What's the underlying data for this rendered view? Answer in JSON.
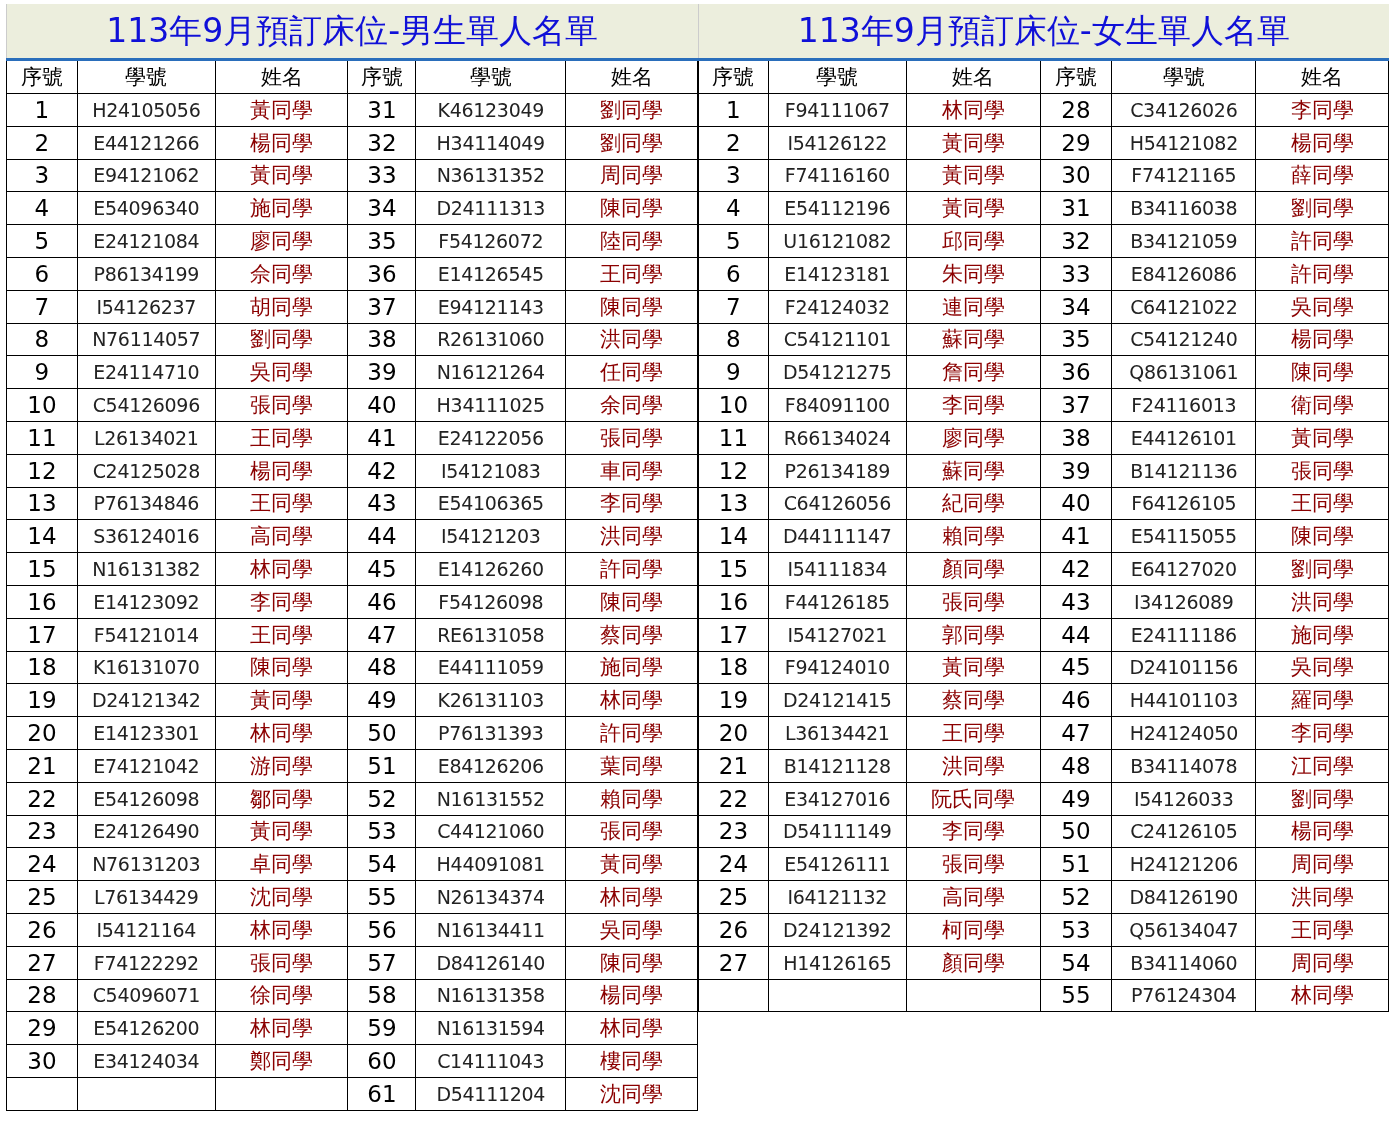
{
  "sheets": [
    {
      "title": "113年9月預訂床位-男生單人名單",
      "columns": [
        "序號",
        "學號",
        "姓名",
        "序號",
        "學號",
        "姓名"
      ],
      "left": [
        {
          "no": "1",
          "id": "H24105056",
          "name": "黃同學"
        },
        {
          "no": "2",
          "id": "E44121266",
          "name": "楊同學"
        },
        {
          "no": "3",
          "id": "E94121062",
          "name": "黃同學"
        },
        {
          "no": "4",
          "id": "E54096340",
          "name": "施同學"
        },
        {
          "no": "5",
          "id": "E24121084",
          "name": "廖同學"
        },
        {
          "no": "6",
          "id": "P86134199",
          "name": "佘同學"
        },
        {
          "no": "7",
          "id": "I54126237",
          "name": "胡同學"
        },
        {
          "no": "8",
          "id": "N76114057",
          "name": "劉同學"
        },
        {
          "no": "9",
          "id": "E24114710",
          "name": "吳同學"
        },
        {
          "no": "10",
          "id": "C54126096",
          "name": "張同學"
        },
        {
          "no": "11",
          "id": "L26134021",
          "name": "王同學"
        },
        {
          "no": "12",
          "id": "C24125028",
          "name": "楊同學"
        },
        {
          "no": "13",
          "id": "P76134846",
          "name": "王同學"
        },
        {
          "no": "14",
          "id": "S36124016",
          "name": "高同學"
        },
        {
          "no": "15",
          "id": "N16131382",
          "name": "林同學"
        },
        {
          "no": "16",
          "id": "E14123092",
          "name": "李同學"
        },
        {
          "no": "17",
          "id": "F54121014",
          "name": "王同學"
        },
        {
          "no": "18",
          "id": "K16131070",
          "name": "陳同學"
        },
        {
          "no": "19",
          "id": "D24121342",
          "name": "黃同學"
        },
        {
          "no": "20",
          "id": "E14123301",
          "name": "林同學"
        },
        {
          "no": "21",
          "id": "E74121042",
          "name": "游同學"
        },
        {
          "no": "22",
          "id": "E54126098",
          "name": "鄒同學"
        },
        {
          "no": "23",
          "id": "E24126490",
          "name": "黃同學"
        },
        {
          "no": "24",
          "id": "N76131203",
          "name": "卓同學"
        },
        {
          "no": "25",
          "id": "L76134429",
          "name": "沈同學"
        },
        {
          "no": "26",
          "id": "I54121164",
          "name": "林同學"
        },
        {
          "no": "27",
          "id": "F74122292",
          "name": "張同學"
        },
        {
          "no": "28",
          "id": "C54096071",
          "name": "徐同學"
        },
        {
          "no": "29",
          "id": "E54126200",
          "name": "林同學"
        },
        {
          "no": "30",
          "id": "E34124034",
          "name": "鄭同學"
        }
      ],
      "right": [
        {
          "no": "31",
          "id": "K46123049",
          "name": "劉同學"
        },
        {
          "no": "32",
          "id": "H34114049",
          "name": "劉同學"
        },
        {
          "no": "33",
          "id": "N36131352",
          "name": "周同學"
        },
        {
          "no": "34",
          "id": "D24111313",
          "name": "陳同學"
        },
        {
          "no": "35",
          "id": "F54126072",
          "name": "陸同學"
        },
        {
          "no": "36",
          "id": "E14126545",
          "name": "王同學"
        },
        {
          "no": "37",
          "id": "E94121143",
          "name": "陳同學"
        },
        {
          "no": "38",
          "id": "R26131060",
          "name": "洪同學"
        },
        {
          "no": "39",
          "id": "N16121264",
          "name": "任同學"
        },
        {
          "no": "40",
          "id": "H34111025",
          "name": "余同學"
        },
        {
          "no": "41",
          "id": "E24122056",
          "name": "張同學"
        },
        {
          "no": "42",
          "id": "I54121083",
          "name": "車同學"
        },
        {
          "no": "43",
          "id": "E54106365",
          "name": "李同學"
        },
        {
          "no": "44",
          "id": "I54121203",
          "name": "洪同學"
        },
        {
          "no": "45",
          "id": "E14126260",
          "name": "許同學"
        },
        {
          "no": "46",
          "id": "F54126098",
          "name": "陳同學"
        },
        {
          "no": "47",
          "id": "RE6131058",
          "name": "蔡同學"
        },
        {
          "no": "48",
          "id": "E44111059",
          "name": "施同學"
        },
        {
          "no": "49",
          "id": "K26131103",
          "name": "林同學"
        },
        {
          "no": "50",
          "id": "P76131393",
          "name": "許同學"
        },
        {
          "no": "51",
          "id": "E84126206",
          "name": "葉同學"
        },
        {
          "no": "52",
          "id": "N16131552",
          "name": "賴同學"
        },
        {
          "no": "53",
          "id": "C44121060",
          "name": "張同學"
        },
        {
          "no": "54",
          "id": "H44091081",
          "name": "黃同學"
        },
        {
          "no": "55",
          "id": "N26134374",
          "name": "林同學"
        },
        {
          "no": "56",
          "id": "N16134411",
          "name": "吳同學"
        },
        {
          "no": "57",
          "id": "D84126140",
          "name": "陳同學"
        },
        {
          "no": "58",
          "id": "N16131358",
          "name": "楊同學"
        },
        {
          "no": "59",
          "id": "N16131594",
          "name": "林同學"
        },
        {
          "no": "60",
          "id": "C14111043",
          "name": "樓同學"
        },
        {
          "no": "61",
          "id": "D54111204",
          "name": "沈同學"
        }
      ]
    },
    {
      "title": "113年9月預訂床位-女生單人名單",
      "columns": [
        "序號",
        "學號",
        "姓名",
        "序號",
        "學號",
        "姓名"
      ],
      "left": [
        {
          "no": "1",
          "id": "F94111067",
          "name": "林同學"
        },
        {
          "no": "2",
          "id": "I54126122",
          "name": "黃同學"
        },
        {
          "no": "3",
          "id": "F74116160",
          "name": "黃同學"
        },
        {
          "no": "4",
          "id": "E54112196",
          "name": "黃同學"
        },
        {
          "no": "5",
          "id": "U16121082",
          "name": "邱同學"
        },
        {
          "no": "6",
          "id": "E14123181",
          "name": "朱同學"
        },
        {
          "no": "7",
          "id": "F24124032",
          "name": "連同學"
        },
        {
          "no": "8",
          "id": "C54121101",
          "name": "蘇同學"
        },
        {
          "no": "9",
          "id": "D54121275",
          "name": "詹同學"
        },
        {
          "no": "10",
          "id": "F84091100",
          "name": "李同學"
        },
        {
          "no": "11",
          "id": "R66134024",
          "name": "廖同學"
        },
        {
          "no": "12",
          "id": "P26134189",
          "name": "蘇同學"
        },
        {
          "no": "13",
          "id": "C64126056",
          "name": "紀同學"
        },
        {
          "no": "14",
          "id": "D44111147",
          "name": "賴同學"
        },
        {
          "no": "15",
          "id": "I54111834",
          "name": "顏同學"
        },
        {
          "no": "16",
          "id": "F44126185",
          "name": "張同學"
        },
        {
          "no": "17",
          "id": "I54127021",
          "name": "郭同學"
        },
        {
          "no": "18",
          "id": "F94124010",
          "name": "黃同學"
        },
        {
          "no": "19",
          "id": "D24121415",
          "name": "蔡同學"
        },
        {
          "no": "20",
          "id": "L36134421",
          "name": "王同學"
        },
        {
          "no": "21",
          "id": "B14121128",
          "name": "洪同學"
        },
        {
          "no": "22",
          "id": "E34127016",
          "name": "阮氏同學"
        },
        {
          "no": "23",
          "id": "D54111149",
          "name": "李同學"
        },
        {
          "no": "24",
          "id": "E54126111",
          "name": "張同學"
        },
        {
          "no": "25",
          "id": "I64121132",
          "name": "高同學"
        },
        {
          "no": "26",
          "id": "D24121392",
          "name": "柯同學"
        },
        {
          "no": "27",
          "id": "H14126165",
          "name": "顏同學"
        }
      ],
      "right": [
        {
          "no": "28",
          "id": "C34126026",
          "name": "李同學"
        },
        {
          "no": "29",
          "id": "H54121082",
          "name": "楊同學"
        },
        {
          "no": "30",
          "id": "F74121165",
          "name": "薛同學"
        },
        {
          "no": "31",
          "id": "B34116038",
          "name": "劉同學"
        },
        {
          "no": "32",
          "id": "B34121059",
          "name": "許同學"
        },
        {
          "no": "33",
          "id": "E84126086",
          "name": "許同學"
        },
        {
          "no": "34",
          "id": "C64121022",
          "name": "吳同學"
        },
        {
          "no": "35",
          "id": "C54121240",
          "name": "楊同學"
        },
        {
          "no": "36",
          "id": "Q86131061",
          "name": "陳同學"
        },
        {
          "no": "37",
          "id": "F24116013",
          "name": "衛同學"
        },
        {
          "no": "38",
          "id": "E44126101",
          "name": "黃同學"
        },
        {
          "no": "39",
          "id": "B14121136",
          "name": "張同學"
        },
        {
          "no": "40",
          "id": "F64126105",
          "name": "王同學"
        },
        {
          "no": "41",
          "id": "E54115055",
          "name": "陳同學"
        },
        {
          "no": "42",
          "id": "E64127020",
          "name": "劉同學"
        },
        {
          "no": "43",
          "id": "I34126089",
          "name": "洪同學"
        },
        {
          "no": "44",
          "id": "E24111186",
          "name": "施同學"
        },
        {
          "no": "45",
          "id": "D24101156",
          "name": "吳同學"
        },
        {
          "no": "46",
          "id": "H44101103",
          "name": "羅同學"
        },
        {
          "no": "47",
          "id": "H24124050",
          "name": "李同學"
        },
        {
          "no": "48",
          "id": "B34114078",
          "name": "江同學"
        },
        {
          "no": "49",
          "id": "I54126033",
          "name": "劉同學"
        },
        {
          "no": "50",
          "id": "C24126105",
          "name": "楊同學"
        },
        {
          "no": "51",
          "id": "H24121206",
          "name": "周同學"
        },
        {
          "no": "52",
          "id": "D84126190",
          "name": "洪同學"
        },
        {
          "no": "53",
          "id": "Q56134047",
          "name": "王同學"
        },
        {
          "no": "54",
          "id": "B34114060",
          "name": "周同學"
        },
        {
          "no": "55",
          "id": "P76124304",
          "name": "林同學"
        }
      ]
    }
  ]
}
